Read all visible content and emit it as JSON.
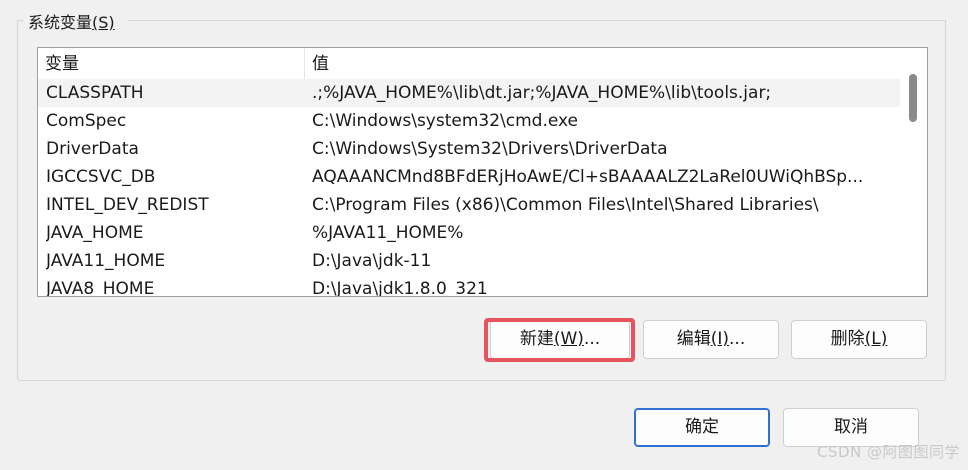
{
  "group": {
    "title": "系统变量",
    "accel": "(S)"
  },
  "table": {
    "columns": [
      "变量",
      "值"
    ],
    "rows": [
      {
        "name": "CLASSPATH",
        "value": ".;%JAVA_HOME%\\lib\\dt.jar;%JAVA_HOME%\\lib\\tools.jar;"
      },
      {
        "name": "ComSpec",
        "value": "C:\\Windows\\system32\\cmd.exe"
      },
      {
        "name": "DriverData",
        "value": "C:\\Windows\\System32\\Drivers\\DriverData"
      },
      {
        "name": "IGCCSVC_DB",
        "value": "AQAAANCMnd8BFdERjHoAwE/Cl+sBAAAALZ2LaRel0UWiQhBSp..."
      },
      {
        "name": "INTEL_DEV_REDIST",
        "value": "C:\\Program Files (x86)\\Common Files\\Intel\\Shared Libraries\\"
      },
      {
        "name": "JAVA_HOME",
        "value": "%JAVA11_HOME%"
      },
      {
        "name": "JAVA11_HOME",
        "value": "D:\\Java\\jdk-11"
      },
      {
        "name": "JAVA8_HOME",
        "value": "D:\\Java\\jdk1.8.0_321"
      }
    ]
  },
  "buttons": {
    "new": {
      "label": "新建",
      "accel": "(W)",
      "suffix": "..."
    },
    "edit": {
      "label": "编辑",
      "accel": "(I)",
      "suffix": "..."
    },
    "delete": {
      "label": "删除",
      "accel": "(L)",
      "suffix": ""
    },
    "ok": "确定",
    "cancel": "取消"
  },
  "watermark": "CSDN @阿图图同学",
  "colors": {
    "highlight": "#e8545e",
    "primary_border": "#2e6fd1"
  }
}
